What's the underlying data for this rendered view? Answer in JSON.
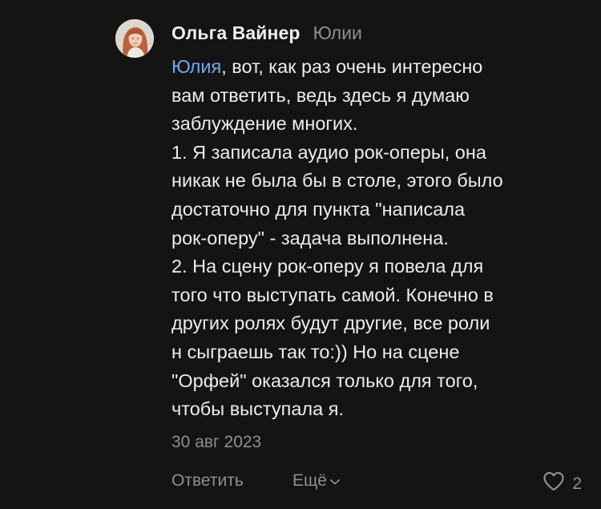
{
  "comment": {
    "avatar_icon": "user-avatar",
    "author": "Ольга Вайнер",
    "reply_to": "Юлии",
    "mention": "Юлия",
    "lines": [
      ", вот, как раз очень интересно",
      "вам ответить, ведь здесь я думаю",
      "заблуждение многих.",
      "1. Я записала аудио рок-оперы, она",
      "никак не была бы в столе, этого было",
      "достаточно для пункта \"написала",
      "рок-оперу\" - задача выполнена.",
      "2. На сцену рок-оперу я повела для",
      "того что выступать самой. Конечно в",
      "других ролях будут другие, все роли",
      "н сыграешь так то:)) Но на сцене",
      "\"Орфей\" оказался только для того,",
      "чтобы выступала я."
    ],
    "date": "30 авг 2023",
    "actions": {
      "reply": "Ответить",
      "more": "Ещё",
      "more_icon": "chevron-down-icon",
      "like_icon": "heart-icon",
      "likes": "2"
    },
    "colors": {
      "background": "#141414",
      "text": "#ececec",
      "secondary": "#8e8e93",
      "mention": "#71aaeb"
    }
  }
}
